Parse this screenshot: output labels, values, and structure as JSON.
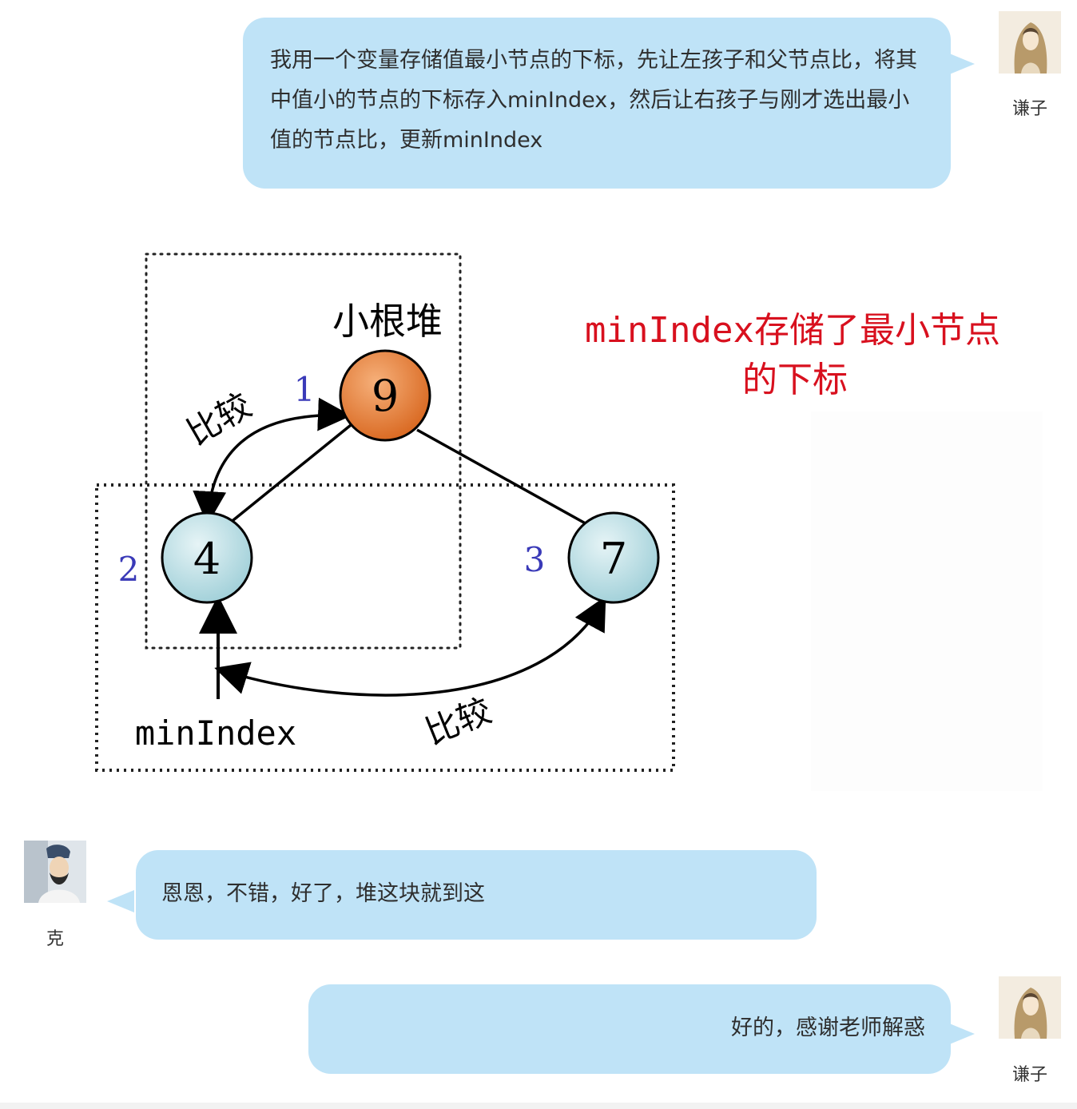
{
  "messages": [
    {
      "sender": "谦子",
      "text": "我用一个变量存储值最小节点的下标，先让左孩子和父节点比，将其中值小的节点的下标存入minIndex，然后让右孩子与刚才选出最小值的节点比，更新minIndex"
    },
    {
      "sender": "克",
      "text": "恩恩，不错，好了，堆这块就到这"
    },
    {
      "sender": "谦子",
      "text": "好的，感谢老师解惑"
    }
  ],
  "diagram": {
    "heap_label": "小根堆",
    "annotation_line1": "minIndex存储了最小节点",
    "annotation_line2": "的下标",
    "nodes": {
      "root": {
        "value": "9",
        "index": "1"
      },
      "left": {
        "value": "4",
        "index": "2"
      },
      "right": {
        "value": "7",
        "index": "3"
      }
    },
    "compare_label_1": "比较",
    "compare_label_2": "比较",
    "pointer_label": "minIndex",
    "colors": {
      "root_fill": "#e07a2e",
      "child_fill": "#bde0e6",
      "index_color": "#3a3ab8",
      "annotation_color": "#d8101e"
    }
  },
  "colors": {
    "bubble": "#bfe3f7"
  }
}
